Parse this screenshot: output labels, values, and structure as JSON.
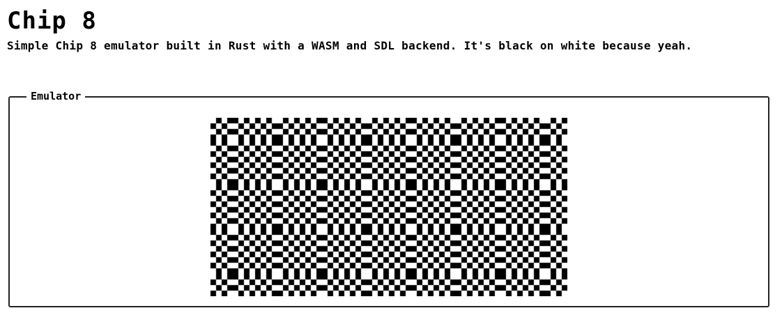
{
  "page": {
    "title": "Chip 8",
    "description": "Simple Chip 8 emulator built in Rust with a WASM and SDL backend. It's black on white because yeah."
  },
  "emulator": {
    "legend": "Emulator",
    "display": {
      "columns": 64,
      "rows": 32,
      "on_color": "#000000",
      "off_color": "#ffffff"
    }
  }
}
